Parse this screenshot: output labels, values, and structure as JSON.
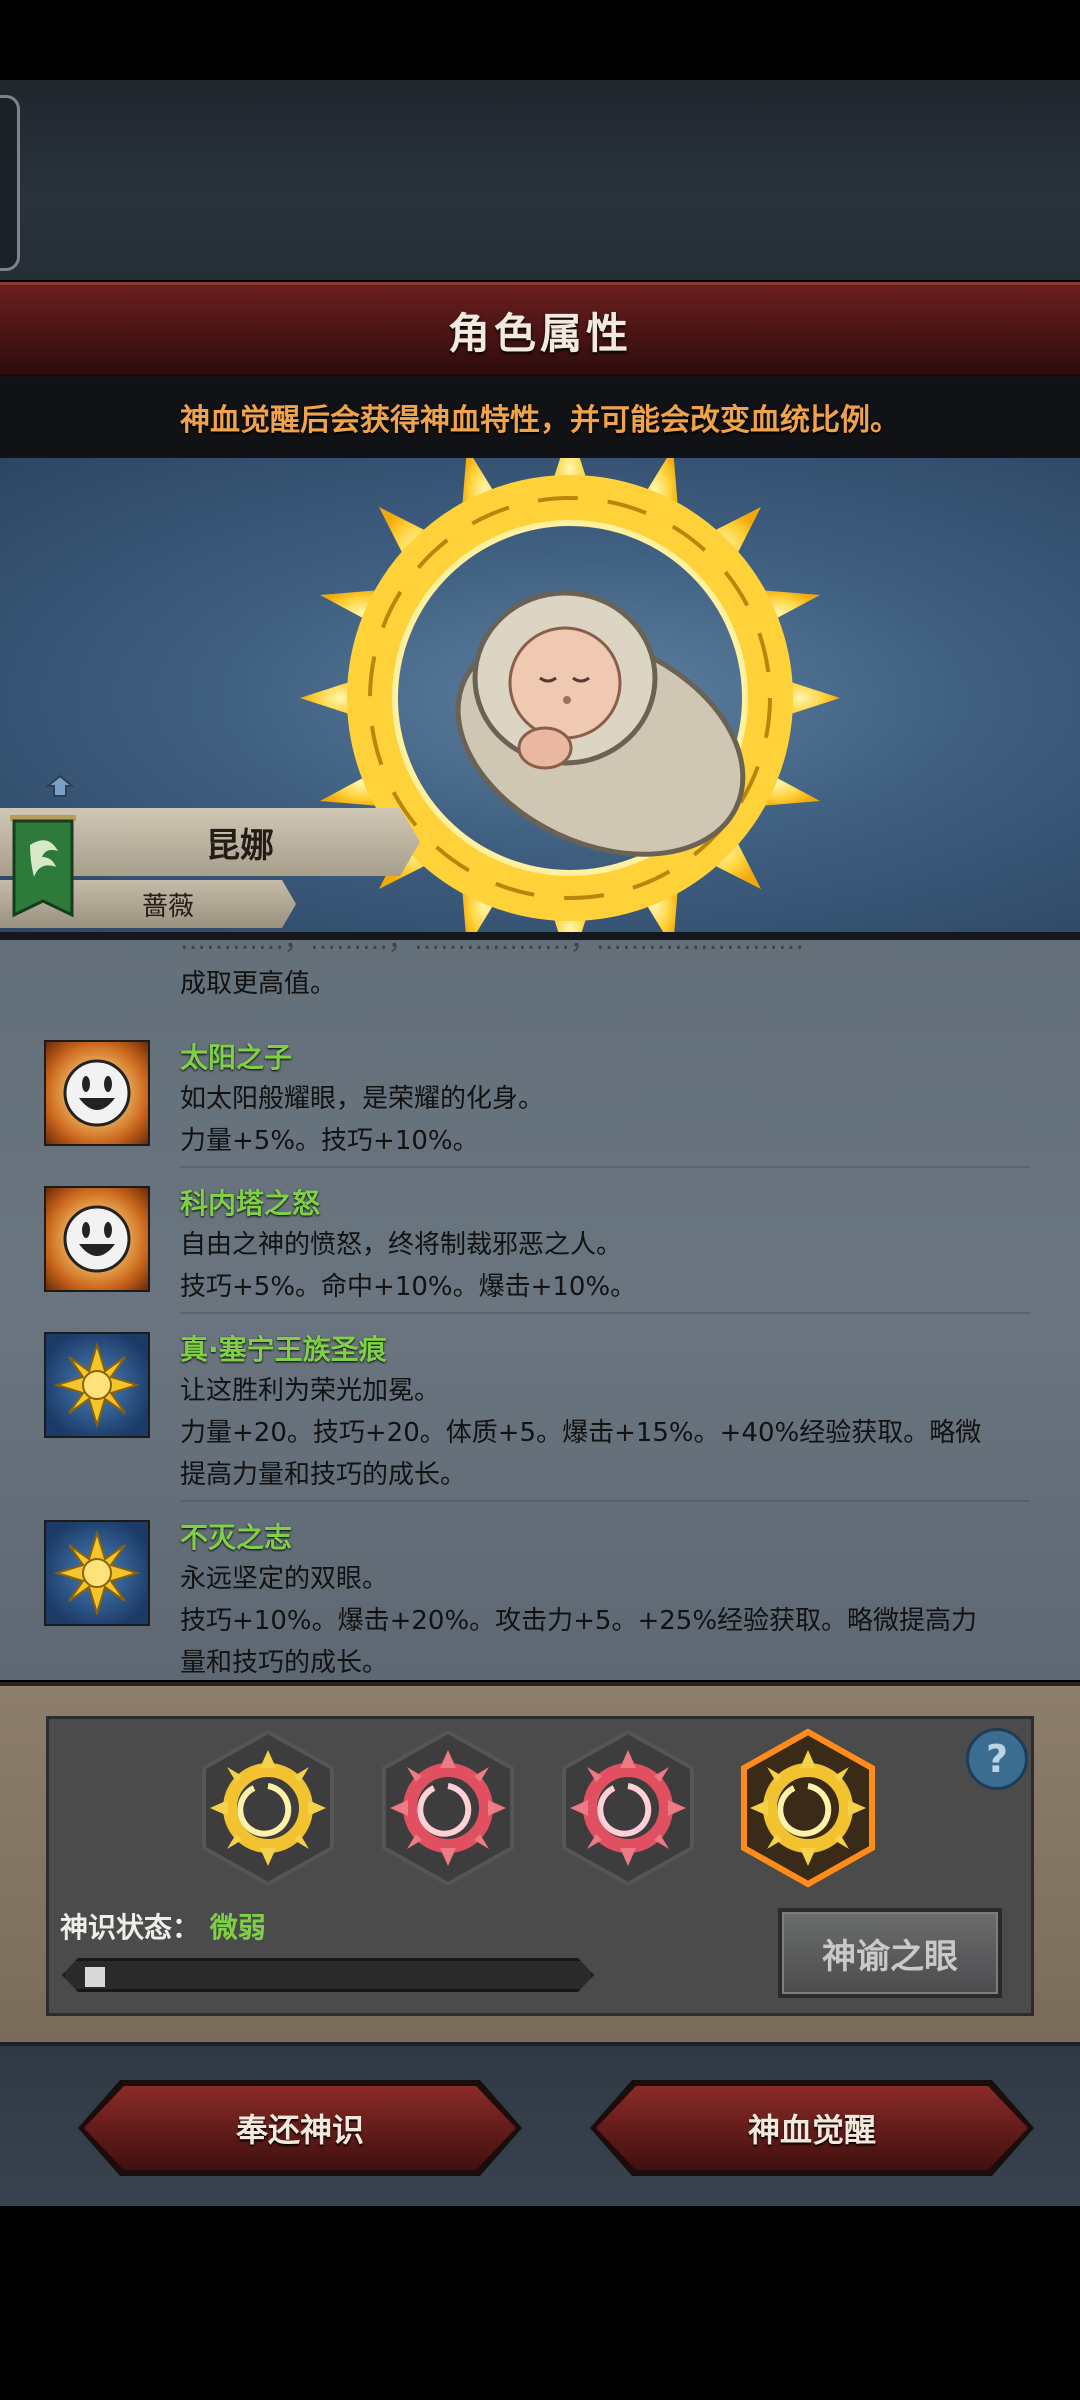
{
  "header": {
    "title": "角色属性"
  },
  "notice": {
    "text": "神血觉醒后会获得神血特性，并可能会改变血统比例。"
  },
  "character": {
    "name": "昆娜",
    "subtitle": "蔷薇"
  },
  "traits": {
    "cut_line_1": "…………，………，………………，……………………",
    "cut_line_2": "成取更高值。",
    "items": [
      {
        "name": "太阳之子",
        "desc": "如太阳般耀眼，是荣耀的化身。",
        "effect": "力量+5%。技巧+10%。",
        "icon": "smiley-sun-icon"
      },
      {
        "name": "科内塔之怒",
        "desc": "自由之神的愤怒，终将制裁邪恶之人。",
        "effect": "技巧+5%。命中+10%。爆击+10%。",
        "icon": "smiley-sun-icon"
      },
      {
        "name": "真·塞宁王族圣痕",
        "desc": "让这胜利为荣光加冕。",
        "effect": "力量+20。技巧+20。体质+5。爆击+15%。+40%经验获取。略微",
        "effect2": "提高力量和技巧的成长。",
        "icon": "golden-sun-icon"
      },
      {
        "name": "不灭之志",
        "desc": "永远坚定的双眼。",
        "effect": "技巧+10%。爆击+20%。攻击力+5。+25%经验获取。略微提高力",
        "effect2": "量和技巧的成长。",
        "icon": "golden-sun-icon"
      }
    ]
  },
  "panel": {
    "state_label": "神识状态：",
    "state_value": "微弱",
    "progress": 0.04,
    "oracle_button": "神谕之眼",
    "help": "?"
  },
  "buttons": {
    "return": "奉还神识",
    "awaken": "神血觉醒"
  },
  "colors": {
    "accent_green": "#7fd046",
    "notice_orange": "#f0a34a",
    "title_red": "#5a1818"
  }
}
